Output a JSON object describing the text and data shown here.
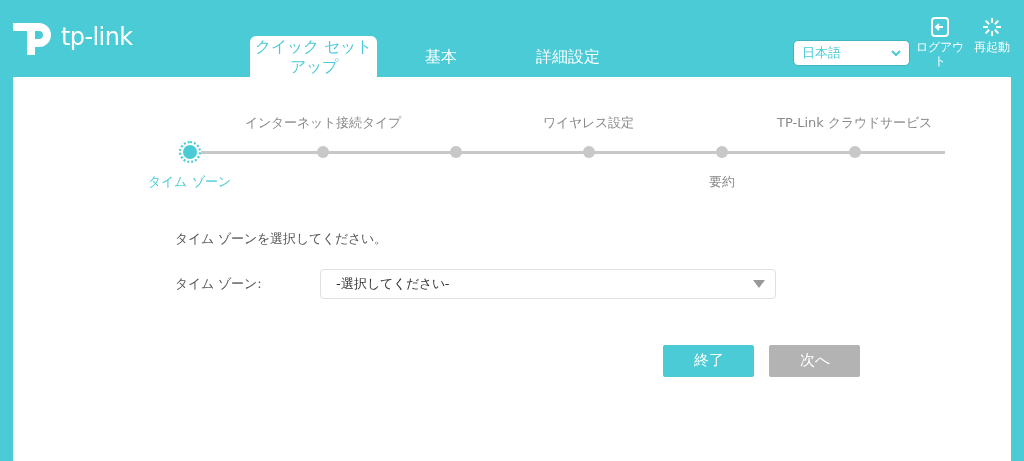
{
  "brand": "tp-link",
  "tabs": [
    {
      "label": "クイック セットアップ",
      "selected": true
    },
    {
      "label": "基本",
      "selected": false
    },
    {
      "label": "詳細設定",
      "selected": false
    }
  ],
  "language": {
    "value": "日本語"
  },
  "actions": [
    {
      "kind": "logout",
      "label": "ログアウト"
    },
    {
      "kind": "reboot",
      "label": "再起動"
    }
  ],
  "steps": [
    {
      "label": "タイム ゾーン",
      "kind": "below",
      "selected": true
    },
    {
      "label": "インターネット接続タイプ",
      "kind": "above",
      "selected": false
    },
    {
      "selected": false
    },
    {
      "label": "ワイヤレス設定",
      "kind": "above",
      "selected": false
    },
    {
      "label": "要約",
      "kind": "below",
      "selected": false
    },
    {
      "label": "TP-Link クラウドサービス",
      "kind": "above",
      "selected": false
    }
  ],
  "prompt": "タイム ゾーンを選択してください。",
  "timezone": {
    "label": "タイム ゾーン:",
    "value": "-選択してください-"
  },
  "buttons": [
    {
      "label": "終了",
      "disabled": false
    },
    {
      "label": "次へ",
      "disabled": true
    }
  ]
}
